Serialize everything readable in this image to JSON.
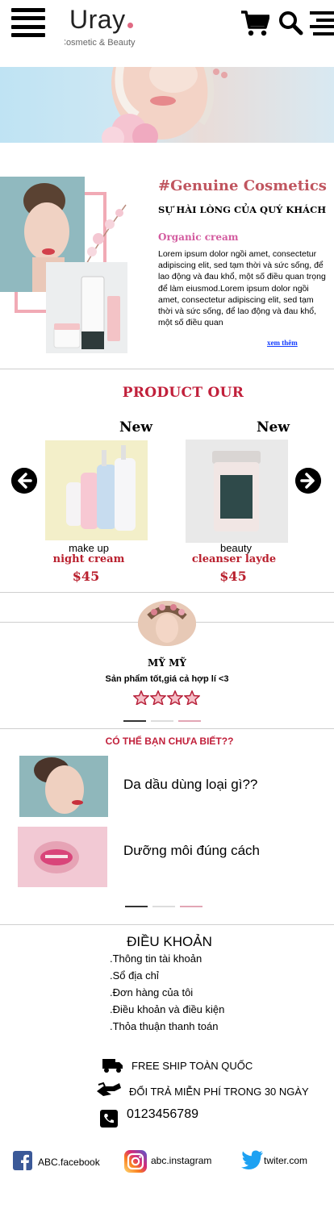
{
  "header": {
    "logo": "Uray",
    "logo_sub": "Cosmetic & Beauty"
  },
  "intro": {
    "heading": "#Genuine Cosmetics",
    "subheading": "SỰ HÀI LÒNG CỦA QUÝ KHÁCH",
    "product_label": "Organic cream",
    "body": "Lorem ipsum dolor ngồi amet, consectetur adipiscing elit, sed tạm thời và sức sống, để lao động và đau khổ, một số điều quan trọng để làm eiusmod.Lorem ipsum dolor ngồi amet, consectetur adipiscing elit, sed tạm thời và sức sống, để lao động và đau khổ, một số điều quan",
    "more_link": "xem thêm"
  },
  "products": {
    "title": "PRODUCT  OUR",
    "items": [
      {
        "tag": "New",
        "category": "make up",
        "name": "night cream",
        "price": "$45"
      },
      {
        "tag": "New",
        "category": "beauty",
        "name": "cleanser layde",
        "price": "$45"
      }
    ]
  },
  "review": {
    "name": "MỸ MỸ",
    "text": "Sản phẩm tốt,giá cả hợp lí <3",
    "rating": 4
  },
  "tips": {
    "title": "CÓ THỂ BẠN CHƯA BIẾT??",
    "items": [
      {
        "text": "Da dầu dùng loại gì??"
      },
      {
        "text": "Dưỡng môi đúng cách"
      }
    ]
  },
  "footer": {
    "terms_title": "ĐIỀU KHOẢN",
    "terms": [
      ".Thông tin tài khoản",
      ".Sổ địa chỉ",
      ".Đơn hàng của tôi",
      ".Điều khoản và điều kiện",
      ".Thỏa thuận thanh toán"
    ],
    "shipping": "FREE SHIP TOÀN QUỐC",
    "returns": "ĐỔI TRẢ MIỄN PHÍ TRONG 30 NGÀY",
    "phone": "0123456789",
    "social": {
      "facebook": "ABC.facebook",
      "instagram": "abc.instagram",
      "twitter": "twiter.com"
    }
  },
  "colors": {
    "accent_red": "#c1203b",
    "pink": "#f1aab5",
    "link_blue": "#123cff",
    "facebook": "#3b5998",
    "twitter": "#1da1f2"
  }
}
